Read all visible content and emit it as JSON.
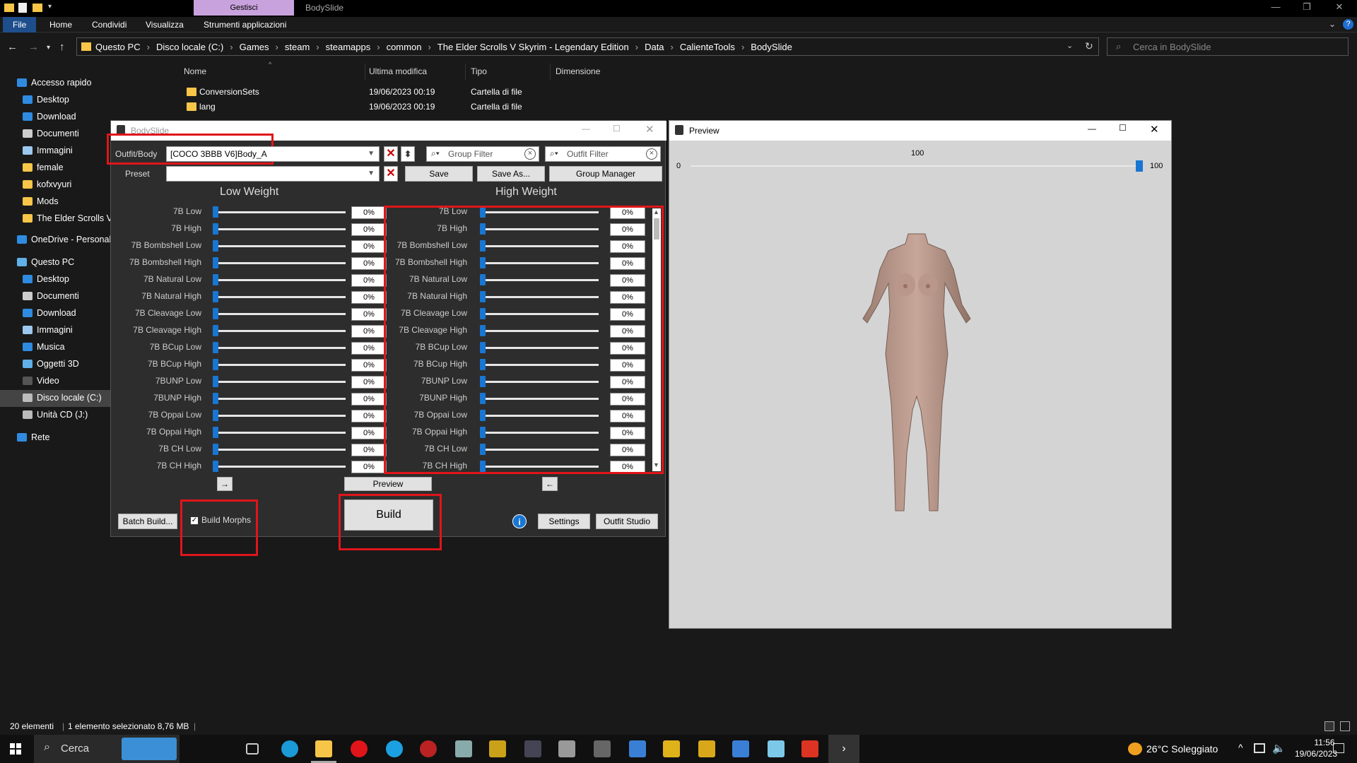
{
  "explorer": {
    "title_tab_context": "Gestisci",
    "title": "BodySlide",
    "ribbon_tabs": [
      "File",
      "Home",
      "Condividi",
      "Visualizza",
      "Strumenti applicazioni"
    ],
    "breadcrumbs": [
      "Questo PC",
      "Disco locale (C:)",
      "Games",
      "steam",
      "steamapps",
      "common",
      "The Elder Scrolls V Skyrim - Legendary Edition",
      "Data",
      "CalienteTools",
      "BodySlide"
    ],
    "search_placeholder": "Cerca in BodySlide",
    "nav": {
      "quick_access": "Accesso rapido",
      "quick_items": [
        "Desktop",
        "Download",
        "Documenti",
        "Immagini",
        "female",
        "kofxvyuri",
        "Mods",
        "The Elder Scrolls V S"
      ],
      "onedrive": "OneDrive - Personal",
      "this_pc": "Questo PC",
      "pc_items": [
        "Desktop",
        "Documenti",
        "Download",
        "Immagini",
        "Musica",
        "Oggetti 3D",
        "Video",
        "Disco locale (C:)",
        "Unità CD (J:)"
      ],
      "network": "Rete"
    },
    "columns": [
      "Nome",
      "Ultima modifica",
      "Tipo",
      "Dimensione"
    ],
    "files": [
      {
        "name": "ConversionSets",
        "modified": "19/06/2023 00:19",
        "type": "Cartella di file"
      },
      {
        "name": "lang",
        "modified": "19/06/2023 00:19",
        "type": "Cartella di file"
      }
    ],
    "status": {
      "count": "20 elementi",
      "selection": "1 elemento selezionato 8,76 MB"
    }
  },
  "bodyslide": {
    "title": "BodySlide",
    "outfit_label": "Outfit/Body",
    "outfit_value": "[COCO 3BBB V6]Body_A",
    "preset_label": "Preset",
    "preset_value": "",
    "group_filter": "Group Filter",
    "outfit_filter": "Outfit Filter",
    "save": "Save",
    "save_as": "Save As...",
    "group_manager": "Group Manager",
    "low_weight": "Low Weight",
    "high_weight": "High Weight",
    "sliders": [
      "7B Low",
      "7B High",
      "7B Bombshell Low",
      "7B Bombshell High",
      "7B Natural Low",
      "7B Natural High",
      "7B Cleavage Low",
      "7B Cleavage High",
      "7B BCup Low",
      "7B BCup High",
      "7BUNP Low",
      "7BUNP High",
      "7B Oppai Low",
      "7B Oppai High",
      "7B CH Low",
      "7B CH High"
    ],
    "low_values": [
      0,
      0,
      0,
      0,
      0,
      0,
      0,
      0,
      0,
      0,
      0,
      0,
      0,
      0,
      0,
      0
    ],
    "high_values": [
      0,
      0,
      0,
      0,
      0,
      0,
      0,
      0,
      0,
      0,
      0,
      0,
      0,
      0,
      0,
      0
    ],
    "low_value_text": [
      "0%",
      "0%",
      "0%",
      "0%",
      "0%",
      "0%",
      "0%",
      "0%",
      "0%",
      "0%",
      "0%",
      "0%",
      "0%",
      "0%",
      "0%",
      "0%"
    ],
    "high_value_text": [
      "0%",
      "0%",
      "0%",
      "0%",
      "0%",
      "0%",
      "0%",
      "0%",
      "0%",
      "0%",
      "0%",
      "0%",
      "0%",
      "0%",
      "0%",
      "0%"
    ],
    "arrow_right": "→",
    "arrow_left": "←",
    "preview": "Preview",
    "batch_build": "Batch Build...",
    "build_morphs": "Build Morphs",
    "build_morphs_checked": true,
    "build": "Build",
    "settings": "Settings",
    "outfit_studio": "Outfit Studio"
  },
  "preview": {
    "title": "Preview",
    "weight_min": "0",
    "weight_current": "100",
    "weight_max": "100",
    "weight_value": 100
  },
  "taskbar": {
    "search": "Cerca",
    "weather": "26°C  Soleggiato",
    "time": "11:56",
    "date": "19/06/2023"
  },
  "colors": {
    "accent": "#1976d2",
    "highlight": "#e0151a",
    "explorer_bg": "#191919"
  }
}
